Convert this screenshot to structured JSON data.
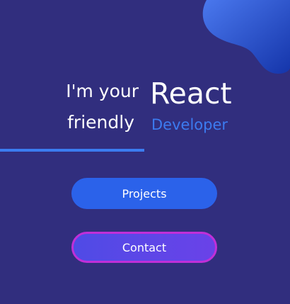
{
  "hero": {
    "greeting_line1": "I'm your",
    "greeting_line2": "friendly",
    "role_main": "React",
    "role_sub": "Developer"
  },
  "buttons": {
    "projects": "Projects",
    "contact": "Contact"
  },
  "colors": {
    "background": "#312e7e",
    "accent_blue": "#3b7cf0",
    "button_primary": "#2b62ea",
    "button_secondary_border": "#c02fd8",
    "blob_dark": "#1633a8",
    "blob_light": "#3d68e8"
  }
}
